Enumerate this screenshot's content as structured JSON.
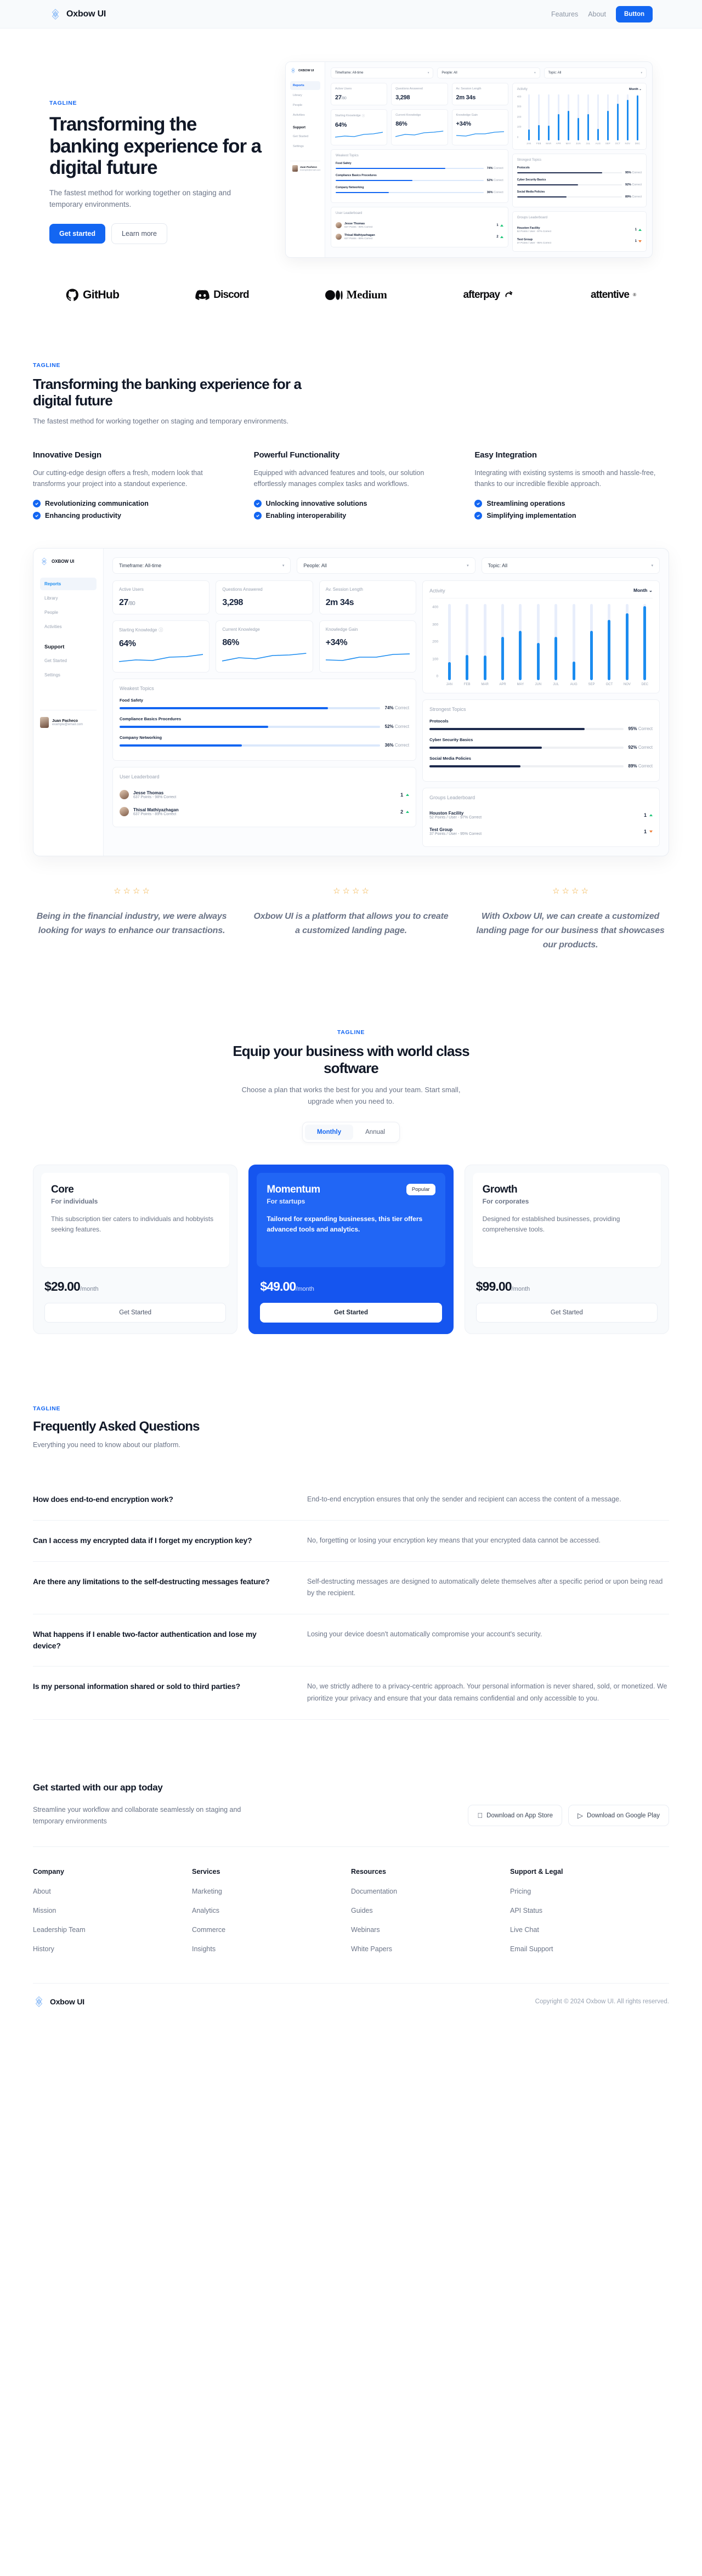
{
  "brand": {
    "name": "Oxbow UI",
    "logo_icon": "oxbow-lattice-logo"
  },
  "nav": {
    "links": [
      {
        "label": "Features"
      },
      {
        "label": "About"
      }
    ],
    "button_label": "Button"
  },
  "hero": {
    "tagline": "TAGLINE",
    "heading": "Transforming the banking experience for a digital future",
    "subheading": "The fastest method for working together on staging and temporary environments.",
    "primary_cta": "Get started",
    "secondary_cta": "Learn more"
  },
  "logos": [
    {
      "name": "GitHub",
      "icon": "github-icon"
    },
    {
      "name": "Discord",
      "icon": "discord-icon"
    },
    {
      "name": "Medium",
      "icon": "medium-icon"
    },
    {
      "name": "afterpay",
      "icon": "afterpay-icon"
    },
    {
      "name": "attentive",
      "icon": "attentive-icon"
    }
  ],
  "features": {
    "tagline": "TAGLINE",
    "heading": "Transforming the banking experience for a digital future",
    "subheading": "The fastest method for working together on staging and temporary environments.",
    "columns": [
      {
        "title": "Innovative Design",
        "body": "Our cutting-edge design offers a fresh, modern look that transforms your project into a standout experience.",
        "checks": [
          "Revolutionizing communication",
          "Enhancing productivity"
        ]
      },
      {
        "title": "Powerful Functionality",
        "body": "Equipped with advanced features and tools, our solution effortlessly manages complex tasks and workflows.",
        "checks": [
          "Unlocking innovative solutions",
          "Enabling interoperability"
        ]
      },
      {
        "title": "Easy Integration",
        "body": "Integrating with existing systems is smooth and hassle-free, thanks to our incredible flexible approach.",
        "checks": [
          "Streamlining operations",
          "Simplifying implementation"
        ]
      }
    ]
  },
  "dashboard": {
    "brand": "OXBOW UI",
    "nav_items": [
      "Reports",
      "Library",
      "People",
      "Activities"
    ],
    "nav_active": "Reports",
    "support_title": "Support",
    "support_items": [
      "Get Started",
      "Settings"
    ],
    "user": {
      "name": "Juan Pacheco",
      "email": "example@email.com"
    },
    "filters": [
      {
        "label": "Timeframe: All-time"
      },
      {
        "label": "People: All"
      },
      {
        "label": "Topic: All"
      }
    ],
    "stats": [
      {
        "label": "Active Users",
        "value": "27",
        "suffix": "/80"
      },
      {
        "label": "Questions Answered",
        "value": "3,298",
        "suffix": ""
      },
      {
        "label": "Av. Session Length",
        "value": "2m 34s",
        "suffix": ""
      },
      {
        "label": "Starting Knowledge",
        "value": "64%",
        "suffix": "",
        "info": true
      },
      {
        "label": "Current Knowledge",
        "value": "86%",
        "suffix": ""
      },
      {
        "label": "Knowledge Gain",
        "value": "+34%",
        "suffix": ""
      }
    ],
    "weakest_title": "Weakest Topics",
    "weakest": [
      {
        "topic": "Food Safety",
        "pct": 74,
        "pct_label": "74%",
        "suffix": "Correct"
      },
      {
        "topic": "Compliance Basics Procedures",
        "pct": 52,
        "pct_label": "52%",
        "suffix": "Correct"
      },
      {
        "topic": "Company Networking",
        "pct": 36,
        "pct_label": "36%",
        "suffix": "Correct"
      }
    ],
    "strongest_title": "Strongest Topics",
    "strongest": [
      {
        "topic": "Protocols",
        "pct": 95,
        "pct_label": "95%",
        "suffix": "Correct"
      },
      {
        "topic": "Cyber Security Basics",
        "pct": 92,
        "pct_label": "92%",
        "suffix": "Correct"
      },
      {
        "topic": "Social Media Policies",
        "pct": 89,
        "pct_label": "89%",
        "suffix": "Correct"
      }
    ],
    "user_board_title": "User Leaderboard",
    "user_board": [
      {
        "name": "Jesse Thomas",
        "sub": "637 Points - 98% Correct",
        "rank": "1",
        "dir": "up"
      },
      {
        "name": "Thisal Mathiyazhagan",
        "sub": "637 Points - 89% Correct",
        "rank": "2",
        "dir": "up"
      }
    ],
    "group_board_title": "Groups Leaderboard",
    "group_board": [
      {
        "name": "Houston Facility",
        "sub": "52 Points / User - 97% Correct",
        "rank": "1",
        "dir": "up"
      },
      {
        "name": "Test Group",
        "sub": "37 Points / User - 95% Correct",
        "rank": "1",
        "dir": "down"
      }
    ],
    "chart_data": {
      "type": "bar",
      "title": "Activity",
      "selector": "Month",
      "categories": [
        "JAN",
        "FEB",
        "MAR",
        "APR",
        "MAY",
        "JUN",
        "JUL",
        "AUG",
        "SEP",
        "OCT",
        "NOV",
        "DEC"
      ],
      "values": [
        100,
        138,
        137,
        238,
        272,
        205,
        240,
        103,
        272,
        333,
        368,
        408
      ],
      "yticks": [
        400,
        300,
        200,
        100,
        0
      ],
      "ylim": [
        0,
        420
      ],
      "xlabel": "",
      "ylabel": "",
      "grid": false,
      "legend": "none"
    }
  },
  "testimonials": [
    {
      "stars": 4,
      "quote": "Being in the financial industry, we were always looking for ways to enhance our transactions."
    },
    {
      "stars": 4,
      "quote": "Oxbow UI is a platform that allows you to create a customized landing page."
    },
    {
      "stars": 4,
      "quote": "With Oxbow UI, we can create a customized landing page for our business that showcases our products."
    }
  ],
  "pricing": {
    "tagline": "TAGLINE",
    "heading": "Equip your business with world class software",
    "subheading": "Choose a plan that works the best for you and your team. Start small, upgrade when you need to.",
    "toggle": {
      "options": [
        "Monthly",
        "Annual"
      ],
      "active": "Monthly"
    },
    "plans": [
      {
        "name": "Core",
        "for": "For individuals",
        "desc": "This subscription tier caters to individuals and hobbyists seeking features.",
        "price": "$29.00",
        "period": "/month",
        "cta": "Get Started",
        "badge": "",
        "featured": false
      },
      {
        "name": "Momentum",
        "for": "For startups",
        "desc": "Tailored for expanding businesses, this tier offers advanced tools and analytics.",
        "price": "$49.00",
        "period": "/month",
        "cta": "Get Started",
        "badge": "Popular",
        "featured": true
      },
      {
        "name": "Growth",
        "for": "For corporates",
        "desc": "Designed for established businesses, providing comprehensive tools.",
        "price": "$99.00",
        "period": "/month",
        "cta": "Get Started",
        "badge": "",
        "featured": false
      }
    ]
  },
  "faq": {
    "tagline": "TAGLINE",
    "heading": "Frequently Asked Questions",
    "subheading": "Everything you need to know about our platform.",
    "items": [
      {
        "q": "How does end-to-end encryption work?",
        "a": "End-to-end encryption ensures that only the sender and recipient can access the content of a message."
      },
      {
        "q": "Can I access my encrypted data if I forget my encryption key?",
        "a": "No, forgetting or losing your encryption key means that your encrypted data cannot be accessed."
      },
      {
        "q": "Are there any limitations to the self-destructing messages feature?",
        "a": "Self-destructing messages are designed to automatically delete themselves after a specific period or upon being read by the recipient."
      },
      {
        "q": "What happens if I enable two-factor authentication and lose my device?",
        "a": "Losing your device doesn't automatically compromise your account's security."
      },
      {
        "q": "Is my personal information shared or sold to third parties?",
        "a": "No, we strictly adhere to a privacy-centric approach. Your personal information is never shared, sold, or monetized. We prioritize your privacy and ensure that your data remains confidential and only accessible to you."
      }
    ]
  },
  "cta": {
    "heading": "Get started with our app today",
    "text": "Streamline your workflow and collaborate seamlessly on staging and temporary environments",
    "app_store": "Download on App Store",
    "google_play": "Download on Google Play"
  },
  "footer": {
    "columns": [
      {
        "title": "Company",
        "links": [
          "About",
          "Mission",
          "Leadership Team",
          "History"
        ]
      },
      {
        "title": "Services",
        "links": [
          "Marketing",
          "Analytics",
          "Commerce",
          "Insights"
        ]
      },
      {
        "title": "Resources",
        "links": [
          "Documentation",
          "Guides",
          "Webinars",
          "White Papers"
        ]
      },
      {
        "title": "Support & Legal",
        "links": [
          "Pricing",
          "API Status",
          "Live Chat",
          "Email Support"
        ]
      }
    ],
    "copyright": "Copyright © 2024 Oxbow UI. All rights reserved."
  },
  "colors": {
    "accent": "#1366f2",
    "featured": "#1555ef",
    "star": "#f0a830",
    "up": "#1fc77a",
    "down": "#f07a32"
  }
}
